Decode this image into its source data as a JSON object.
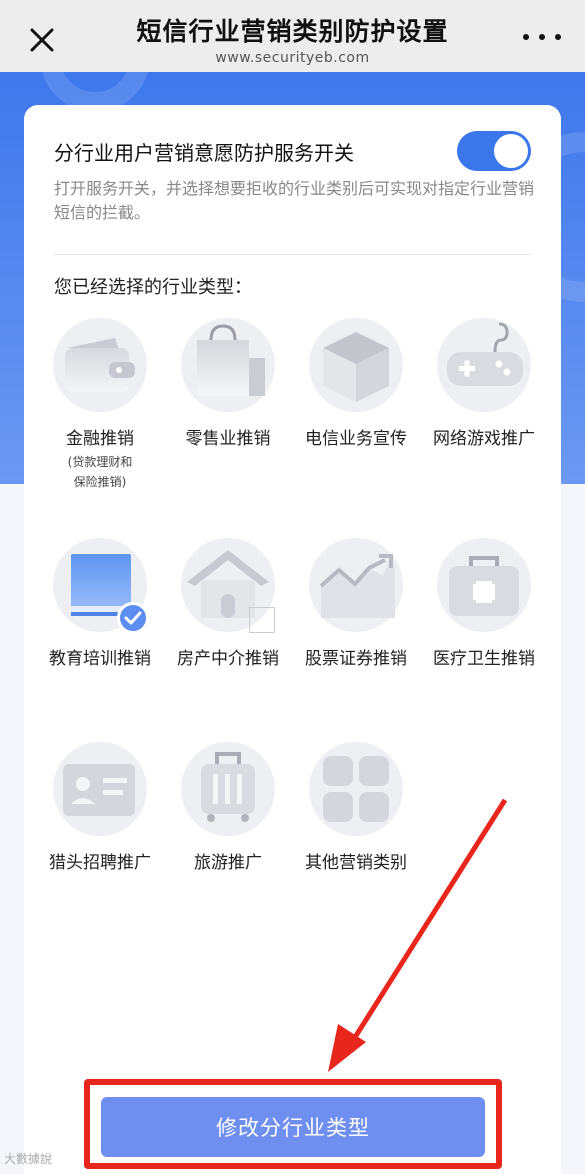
{
  "header": {
    "title": "短信行业营销类别防护设置",
    "subtitle": "www.securityeb.com"
  },
  "toggle": {
    "label": "分行业用户营销意愿防护服务开关",
    "state": "on"
  },
  "description": "打开服务开关，并选择想要拒收的行业类别后可实现对指定行业营销短信的拦截。",
  "section_title": "您已经选择的行业类型：",
  "categories": [
    {
      "label": "金融推销",
      "sub": "(贷款理财和保险推销)",
      "icon": "wallet-icon",
      "selected": false
    },
    {
      "label": "零售业推销",
      "icon": "shopping-bag-icon",
      "selected": false
    },
    {
      "label": "电信业务宣传",
      "icon": "box-icon",
      "selected": false
    },
    {
      "label": "网络游戏推广",
      "icon": "gamepad-icon",
      "selected": false
    },
    {
      "label": "教育培训推销",
      "icon": "book-icon",
      "selected": true
    },
    {
      "label": "房产中介推销",
      "icon": "house-icon",
      "selected": false
    },
    {
      "label": "股票证券推销",
      "icon": "stock-chart-icon",
      "selected": false
    },
    {
      "label": "医疗卫生推销",
      "icon": "medical-kit-icon",
      "selected": false
    },
    {
      "label": "猎头招聘推广",
      "icon": "id-card-icon",
      "selected": false
    },
    {
      "label": "旅游推广",
      "icon": "luggage-icon",
      "selected": false
    },
    {
      "label": "其他营销类别",
      "icon": "grid-icon",
      "selected": false
    }
  ],
  "button": {
    "label": "修改分行业类型"
  },
  "watermark": "大數據說",
  "colors": {
    "accent": "#3b77eb",
    "button": "#6f8ff0",
    "highlight": "#e8261c"
  }
}
